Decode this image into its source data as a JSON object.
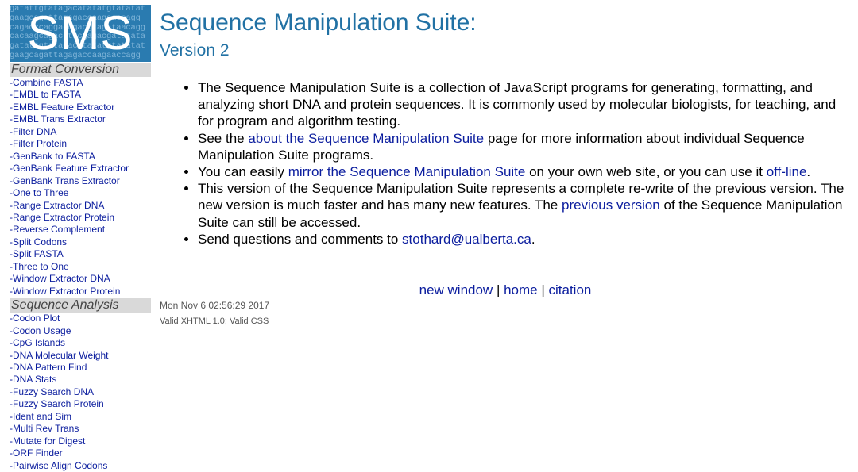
{
  "logo": {
    "text": "SMS",
    "background_sequence": [
      "gatattgtatagacatatatgtatatat",
      "gaagcagattagagaccaagaaccagg",
      "cagacccaggagcgacgtagataacagg",
      "cacaagcagacgtacgagacgatatata"
    ]
  },
  "sidebar": {
    "sections": [
      {
        "heading": "Format Conversion",
        "items": [
          "-Combine FASTA",
          "-EMBL to FASTA",
          "-EMBL Feature Extractor",
          "-EMBL Trans Extractor",
          "-Filter DNA",
          "-Filter Protein",
          "-GenBank to FASTA",
          "-GenBank Feature Extractor",
          "-GenBank Trans Extractor",
          "-One to Three",
          "-Range Extractor DNA",
          "-Range Extractor Protein",
          "-Reverse Complement",
          "-Split Codons",
          "-Split FASTA",
          "-Three to One",
          "-Window Extractor DNA",
          "-Window Extractor Protein"
        ]
      },
      {
        "heading": "Sequence Analysis",
        "items": [
          "-Codon Plot",
          "-Codon Usage",
          "-CpG Islands",
          "-DNA Molecular Weight",
          "-DNA Pattern Find",
          "-DNA Stats",
          "-Fuzzy Search DNA",
          "-Fuzzy Search Protein",
          "-Ident and Sim",
          "-Multi Rev Trans",
          "-Mutate for Digest",
          "-ORF Finder",
          "-Pairwise Align Codons"
        ]
      }
    ]
  },
  "main": {
    "title": "Sequence Manipulation Suite:",
    "subtitle": "Version 2",
    "bullets": [
      {
        "parts": [
          {
            "text": "The Sequence Manipulation Suite is a collection of JavaScript programs for generating, formatting, and analyzing short DNA and protein sequences. It is commonly used by molecular biologists, for teaching, and for program and algorithm testing."
          }
        ]
      },
      {
        "parts": [
          {
            "text": "See the "
          },
          {
            "text": "about the Sequence Manipulation Suite",
            "link": true
          },
          {
            "text": " page for more information about individual Sequence Manipulation Suite programs."
          }
        ]
      },
      {
        "parts": [
          {
            "text": "You can easily "
          },
          {
            "text": "mirror the Sequence Manipulation Suite",
            "link": true
          },
          {
            "text": " on your own web site, or you can use it "
          },
          {
            "text": "off-line",
            "link": true
          },
          {
            "text": "."
          }
        ]
      },
      {
        "parts": [
          {
            "text": "This version of the Sequence Manipulation Suite represents a complete re-write of the previous version. The new version is much faster and has many new features. The "
          },
          {
            "text": "previous version",
            "link": true
          },
          {
            "text": " of the Sequence Manipulation Suite can still be accessed."
          }
        ]
      },
      {
        "parts": [
          {
            "text": "Send questions and comments to "
          },
          {
            "text": "stothard@ualberta.ca",
            "link": true
          },
          {
            "text": "."
          }
        ]
      }
    ]
  },
  "footer": {
    "links": [
      "new window",
      "home",
      "citation"
    ],
    "separator": " | ",
    "date": "Mon Nov 6 02:56:29 2017",
    "validity": "Valid XHTML 1.0; Valid CSS"
  },
  "colors": {
    "heading": "#2171a4",
    "link": "#0b1d9e",
    "logo_bg": "#2a7bb0",
    "section_bg": "#d9d9d9"
  }
}
